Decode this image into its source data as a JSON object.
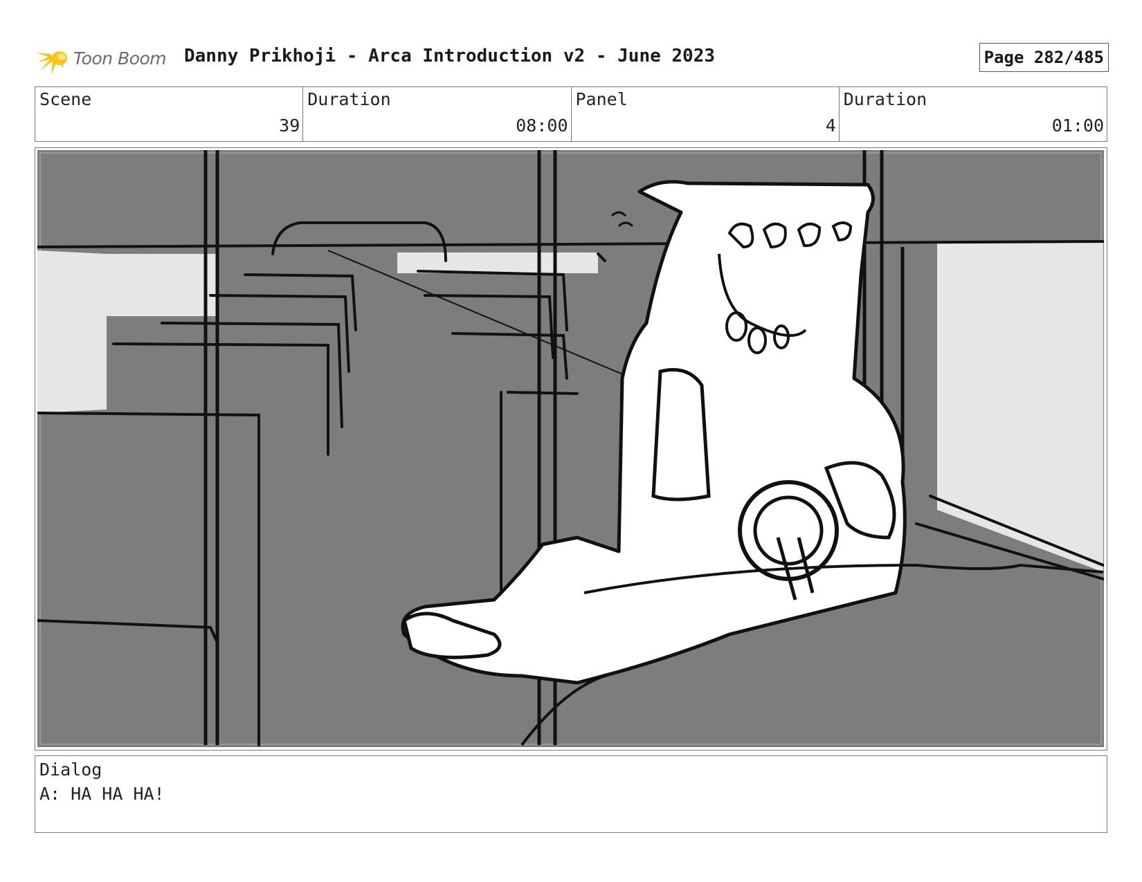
{
  "header": {
    "logo_text": "Toon Boom",
    "title": "Danny Prikhoji - Arca Introduction v2 - June 2023",
    "page_label": "Page 282/485"
  },
  "info": {
    "scene_label": "Scene",
    "scene_value": "39",
    "duration_label": "Duration",
    "duration_value": "08:00",
    "panel_label": "Panel",
    "panel_value": "4",
    "panel_duration_label": "Duration",
    "panel_duration_value": "01:00"
  },
  "dialog": {
    "label": "Dialog",
    "text": "A: HA HA HA!"
  },
  "colors": {
    "logo_accent": "#f7c417",
    "sketch_fill": "#7d7d7d",
    "sketch_light": "#e6e6e6"
  }
}
